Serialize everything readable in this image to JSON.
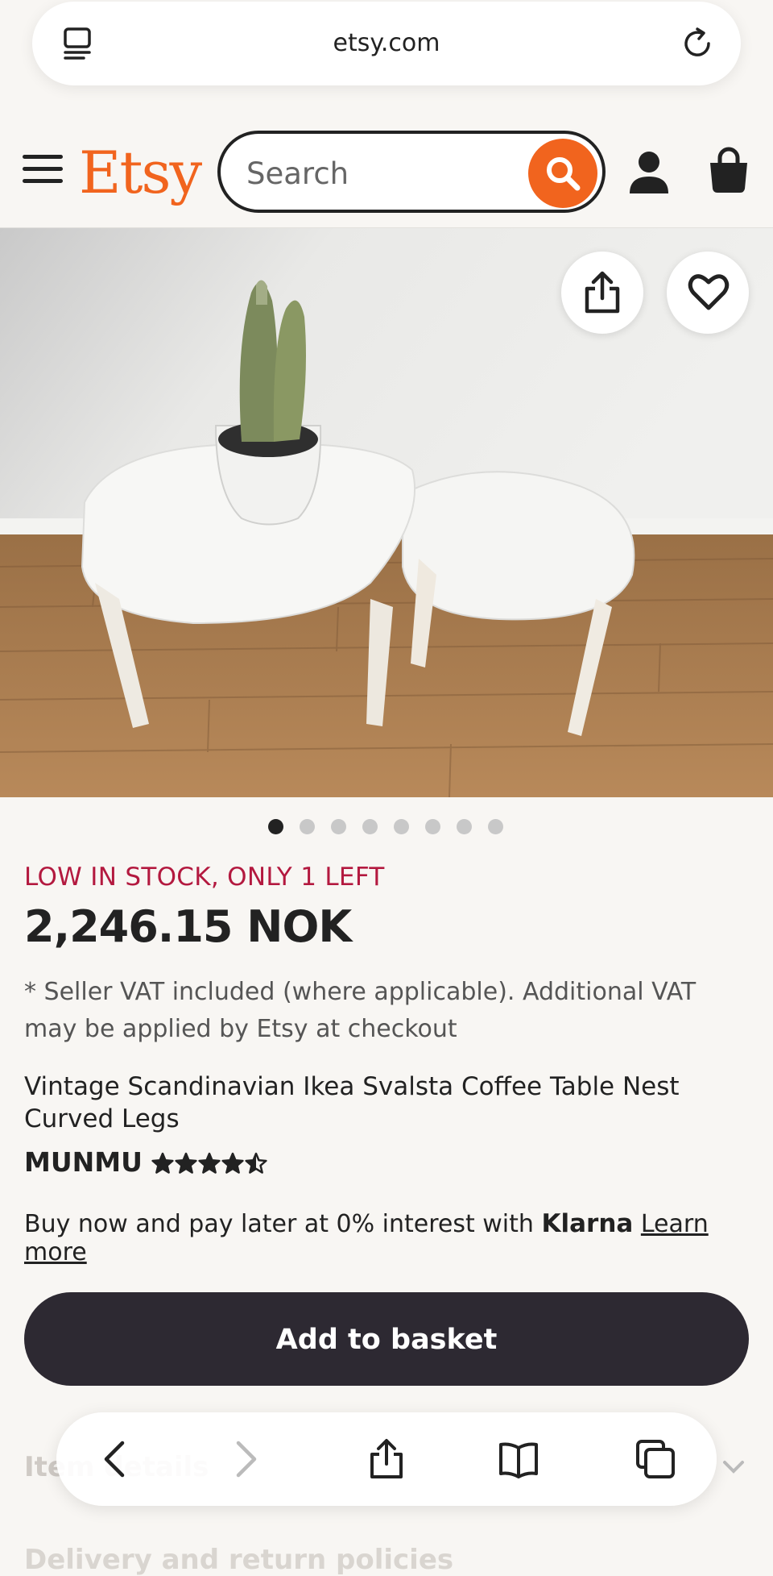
{
  "browser": {
    "url": "etsy.com",
    "tabs_icon": "tab-overview-icon",
    "reload_icon": "reload-icon"
  },
  "header": {
    "logo": "Etsy",
    "search_placeholder": "Search",
    "icons": [
      "hamburger-menu-icon",
      "search-icon",
      "user-icon",
      "shopping-bag-icon"
    ],
    "brand_color": "#f1641e"
  },
  "gallery": {
    "image_count": 8,
    "active_index": 0,
    "action_icons": [
      "share-icon",
      "heart-icon"
    ]
  },
  "product": {
    "stock_notice": "LOW IN STOCK, ONLY 1 LEFT",
    "price": "2,246.15 NOK",
    "vat_note": "* Seller VAT included (where applicable). Additional VAT may be applied by Etsy at checkout",
    "title": "Vintage Scandinavian Ikea Svalsta Coffee Table Nest Curved Legs",
    "shop_name": "MUNMU",
    "rating": 4.5,
    "rating_max": 5,
    "klarna_prefix": "Buy now and pay later at 0% interest with",
    "klarna_brand": "Klarna",
    "klarna_link": "Learn more",
    "add_to_basket": "Add to basket",
    "stock_color": "#b3193f"
  },
  "sections": {
    "item_details": "Item details",
    "delivery": "Delivery and return policies"
  },
  "toolbar": {
    "icons": [
      "back-icon",
      "forward-icon",
      "share-icon",
      "bookmarks-icon",
      "tabs-icon"
    ]
  }
}
